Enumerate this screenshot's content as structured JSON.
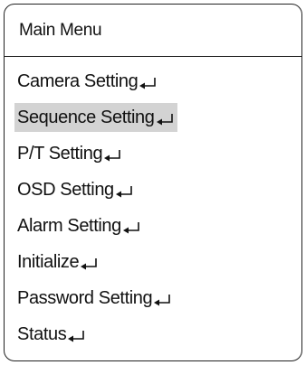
{
  "menu": {
    "title": "Main Menu",
    "selected_index": 1,
    "enter_icon": "enter-return-icon",
    "items": [
      {
        "id": "camera-setting",
        "label": "Camera Setting"
      },
      {
        "id": "sequence-setting",
        "label": "Sequence Setting"
      },
      {
        "id": "pt-setting",
        "label": "P/T Setting"
      },
      {
        "id": "osd-setting",
        "label": "OSD Setting"
      },
      {
        "id": "alarm-setting",
        "label": "Alarm Setting"
      },
      {
        "id": "initialize",
        "label": "Initialize"
      },
      {
        "id": "password-setting",
        "label": "Password Setting"
      },
      {
        "id": "status",
        "label": "Status"
      }
    ]
  }
}
